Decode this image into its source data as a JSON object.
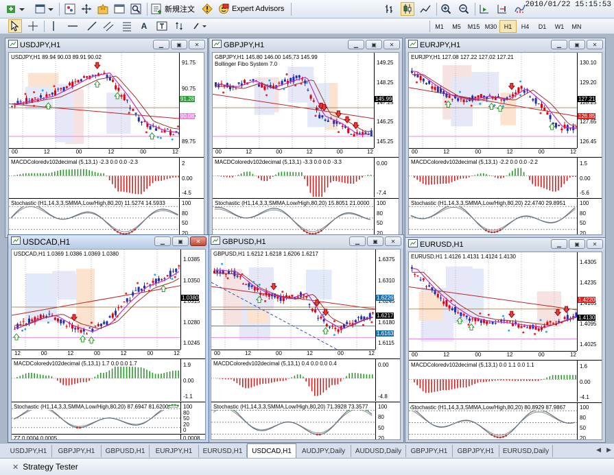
{
  "toolbar": {
    "new_order_label": "新規注文",
    "expert_advisors_label": "Expert Advisors",
    "clock": "2010/01/22 15:15:53",
    "timeframes": [
      "M1",
      "M5",
      "M15",
      "M30",
      "H1",
      "H4",
      "D1",
      "W1",
      "MN"
    ],
    "active_timeframe": "H1"
  },
  "windows": [
    {
      "title": "USDJPY,H1",
      "price_info": "USDJPY,H1  89.94 90.03 89.91 90.02",
      "scale": [
        "91.75",
        "90.75",
        "90.25",
        "89.75"
      ],
      "badges": [
        {
          "text": "91.28",
          "bg": "#2f9e3a"
        },
        {
          "text": "90.08",
          "bg": "#e78ae2"
        }
      ],
      "time_labels": [
        "00",
        "12",
        "00",
        "12",
        "00",
        "12"
      ],
      "macd_label": "MACDColoredv102decimal (5,13,1) -2.3 0.0 0.0 -2.3",
      "macd_scale": [
        "2",
        "0.00",
        "-4.5"
      ],
      "stoch_label": "Stochastic (H1,14,3,3,SMMA,Low/High,80,20) 11.5274 14.5933",
      "stoch_scale": [
        "100",
        "80",
        "50",
        "20"
      ]
    },
    {
      "title": "GBPJPY,H1",
      "price_info": "GBPJPY,H1  145.80 146.00 145.73 145.99",
      "extra_label": "Bollinger Fibo System 7.0",
      "scale": [
        "149.25",
        "148.25",
        "147.25",
        "146.25",
        "145.25"
      ],
      "badges": [
        {
          "text": "145.99",
          "bg": "#000000"
        }
      ],
      "time_labels": [
        "00",
        "12",
        "00",
        "12",
        "00",
        "12"
      ],
      "macd_label": "MACDColoredv102decimal (5,13,1) -3.3 0.0 0.0 -3.3",
      "macd_scale": [
        "0.00",
        "-7.4"
      ],
      "stoch_label": "Stochastic (H1,14,3,3,SMMA,Low/High,80,20) 15.8051 21.0000",
      "stoch_scale": [
        "100",
        "80",
        "50",
        "20"
      ]
    },
    {
      "title": "EURJPY,H1",
      "price_info": "EURJPY,H1  127.08 127.22 127.02 127.21",
      "scale": [
        "130.10",
        "129.20",
        "128.25",
        "127.65",
        "126.45"
      ],
      "badges": [
        {
          "text": "127.21",
          "bg": "#000000"
        },
        {
          "text": "126.85",
          "bg": "#e0231f"
        }
      ],
      "time_labels": [
        "00",
        "12",
        "00",
        "12",
        "00",
        "12"
      ],
      "macd_label": "MACDColoredv102decimal (5,13,1) -2.2 0.0 0.0 -2.2",
      "macd_scale": [
        "1.5",
        "0.00",
        "-5.6"
      ],
      "stoch_label": "Stochastic (H1,14,3,3,SMMA,Low/High,80,20) 22.4740 29.8951",
      "stoch_scale": [
        "100",
        "80",
        "50",
        "20"
      ]
    },
    {
      "title": "USDCAD,H1",
      "price_info": "USDCAD,H1  1.0369 1.0386 1.0369 1.0380",
      "scale": [
        "1.0385",
        "1.0350",
        "1.0315",
        "1.0280",
        "1.0245"
      ],
      "badges": [
        {
          "text": "1.0380",
          "bg": "#000000"
        }
      ],
      "time_labels": [
        "12",
        "00",
        "12",
        "00",
        "12",
        "00",
        "12"
      ],
      "macd_label": "MACDColoredv102decimal (5,13,1) 1.7 0.0 0.0 1.7",
      "macd_scale": [
        "1.9",
        "0.00",
        "-1.1"
      ],
      "stoch_label": "Stochastic (H1,14,3,3,SMMA,Low/High,80,20) 87.6947 81.6200",
      "stoch_scale": [
        "100",
        "80",
        "50",
        "20",
        "0"
      ],
      "extra_bottom": "ZZ 0.0004 0.0005",
      "extra_bottom_scale": "0.0008"
    },
    {
      "title": "GBPUSD,H1",
      "price_info": "GBPUSD,H1  1.6212 1.6218 1.6206 1.6217",
      "scale": [
        "1.6375",
        "1.6310",
        "1.6245",
        "1.6180",
        "1.6115"
      ],
      "badges": [
        {
          "text": "1.6226",
          "bg": "#1a6fb3"
        },
        {
          "text": "1.6217",
          "bg": "#000000"
        },
        {
          "text": "1.6163",
          "bg": "#1a6fb3"
        }
      ],
      "time_labels": [
        "00",
        "12",
        "00",
        "12",
        "00",
        "12"
      ],
      "macd_label": "MACDColoredv102decimal (5,13,1) 0.4 0.0 0.0 0.4",
      "macd_scale": [
        "0.00",
        "-4.8"
      ],
      "stoch_label": "Stochastic (H1,14,3,3,SMMA,Low/High,80,20) 71.3928 73.3577",
      "stoch_scale": [
        "100",
        "80",
        "50",
        "20"
      ]
    },
    {
      "title": "EURUSD,H1",
      "price_info": "EURUSD,H1  1.4126 1.4131 1.4124 1.4130",
      "scale": [
        "1.4305",
        "1.4235",
        "1.4165",
        "1.4095",
        "1.4025"
      ],
      "badges": [
        {
          "text": "1.4220",
          "bg": "#e0231f"
        },
        {
          "text": "1.4130",
          "bg": "#000000"
        }
      ],
      "time_labels": [
        "00",
        "12",
        "00",
        "12",
        "00",
        "12"
      ],
      "macd_label": "MACDColoredv102decimal (5,13,1) 0.0 1.1 0.0 1.1",
      "macd_scale": [
        "1.6",
        "0.00",
        "-4.1"
      ],
      "stoch_label": "Stochastic (H1,14,3,3,SMMA,Low/High,80,20) 80.8929 87.9867",
      "stoch_scale": [
        "100",
        "80",
        "50",
        "20"
      ]
    }
  ],
  "tabs": [
    "USDJPY,H1",
    "GBPJPY,H1",
    "GBPUSD,H1",
    "EURJPY,H1",
    "EURUSD,H1",
    "USDCAD,H1",
    "AUDJPY,Daily",
    "AUDUSD,Daily",
    "GBPJPY,H1",
    "GBPJPY,H1",
    "EURUSD,Daily"
  ],
  "active_tab": "USDCAD,H1",
  "strategy_tester_label": "Strategy Tester"
}
